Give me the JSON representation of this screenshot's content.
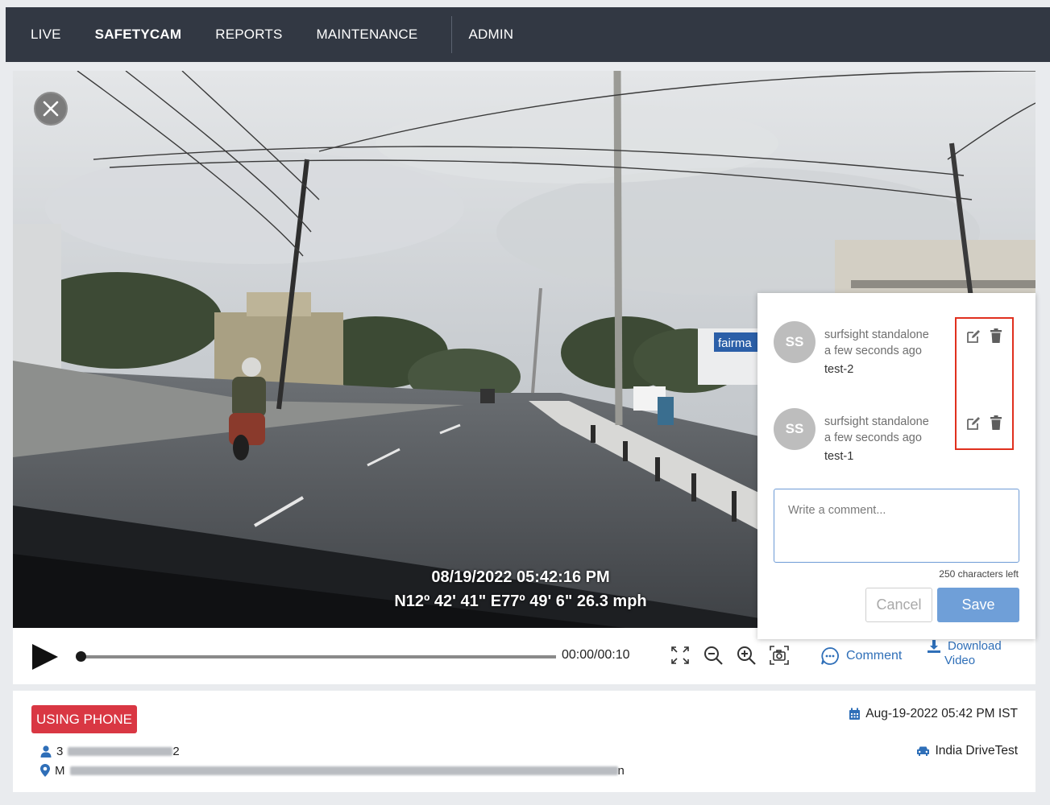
{
  "nav": {
    "items": [
      {
        "label": "LIVE"
      },
      {
        "label": "SAFETYCAM"
      },
      {
        "label": "REPORTS"
      },
      {
        "label": "MAINTENANCE"
      },
      {
        "label": "ADMIN"
      }
    ],
    "active": "SAFETYCAM"
  },
  "video": {
    "overlay_timestamp": "08/19/2022 05:42:16 PM",
    "overlay_gps": "N12º 42' 41\" E77º 49' 6\" 26.3 mph",
    "storefront_sign": "fairma",
    "close_icon": "close-icon"
  },
  "controls": {
    "time": "00:00/00:10",
    "progress": 0.0,
    "icons": [
      "play-icon",
      "fullscreen-icon",
      "zoom-out-icon",
      "zoom-in-icon",
      "snapshot-icon"
    ],
    "comment_label": "Comment",
    "download_line1": "Download",
    "download_line2": "Video"
  },
  "comments": {
    "items": [
      {
        "initials": "SS",
        "author": "surfsight standalone",
        "time": "a few seconds ago",
        "text": "test-2"
      },
      {
        "initials": "SS",
        "author": "surfsight standalone",
        "time": "a few seconds ago",
        "text": "test-1"
      }
    ],
    "placeholder": "Write a comment...",
    "chars_left": "250 characters left",
    "cancel_label": "Cancel",
    "save_label": "Save"
  },
  "event": {
    "badge": "USING PHONE",
    "datetime": "Aug-19-2022 05:42 PM IST",
    "fleet": "India DriveTest",
    "driver_prefix": "3",
    "driver_suffix": "2",
    "location_prefix": "M",
    "location_suffix": "n"
  },
  "colors": {
    "nav_bg": "#323843",
    "accent_blue": "#2f6fb8",
    "save_bg": "#6f9fd8",
    "badge_red": "#d93743",
    "highlight_red": "#e0301e"
  }
}
